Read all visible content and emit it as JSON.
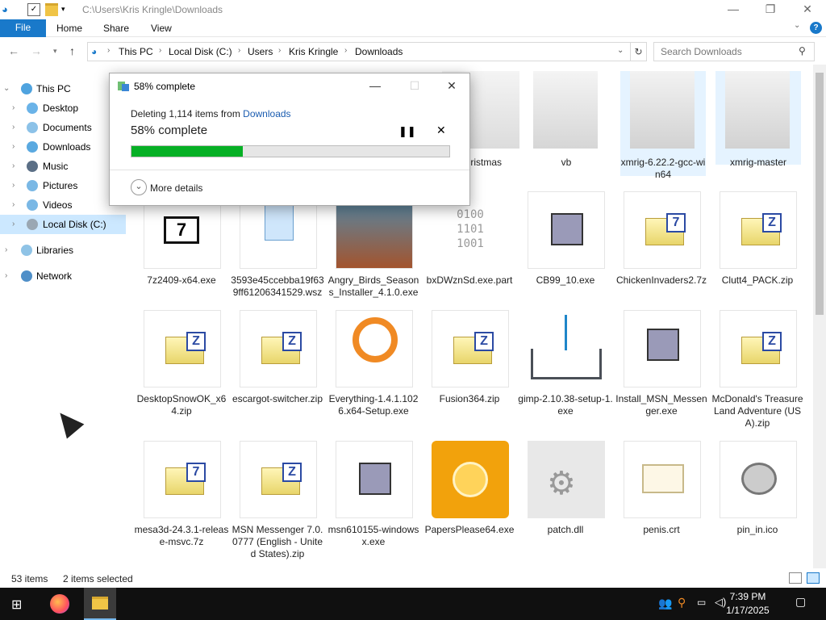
{
  "window": {
    "title": "C:\\Users\\Kris Kringle\\Downloads",
    "minimize": "—",
    "maximize": "❐",
    "close": "✕"
  },
  "ribbon": {
    "file": "File",
    "tabs": [
      "Home",
      "Share",
      "View"
    ],
    "help": "?"
  },
  "address": {
    "crumbs": [
      "This PC",
      "Local Disk (C:)",
      "Users",
      "Kris Kringle",
      "Downloads"
    ],
    "search_placeholder": "Search Downloads"
  },
  "nav": {
    "items": [
      {
        "label": "This PC",
        "icon": "computer-icon"
      },
      {
        "label": "Desktop",
        "icon": "desktop-icon"
      },
      {
        "label": "Documents",
        "icon": "documents-icon"
      },
      {
        "label": "Downloads",
        "icon": "downloads-icon"
      },
      {
        "label": "Music",
        "icon": "music-icon"
      },
      {
        "label": "Pictures",
        "icon": "pictures-icon"
      },
      {
        "label": "Videos",
        "icon": "videos-icon"
      },
      {
        "label": "Local Disk (C:)",
        "icon": "disk-icon"
      },
      {
        "label": "Libraries",
        "icon": "libraries-icon"
      },
      {
        "label": "Network",
        "icon": "network-icon"
      }
    ]
  },
  "files": {
    "row0": [
      {
        "name": "Christmas",
        "icon": "folder-icon"
      },
      {
        "name": "vb",
        "icon": "folder-icon"
      },
      {
        "name": "xmrig-6.22.2-gcc-win64",
        "icon": "folder-icon"
      },
      {
        "name": "xmrig-master",
        "icon": "folder-icon"
      }
    ],
    "row1": [
      {
        "name": "7z2409-x64.exe",
        "icon": "7zip-installer-icon"
      },
      {
        "name": "3593e45ccebba19f639ff61206341529.wsz",
        "icon": "wsz-file-icon"
      },
      {
        "name": "Angry_Birds_Seasons_Installer_4.1.0.exe",
        "icon": "angry-birds-icon"
      },
      {
        "name": "bxDWznSd.exe.part",
        "icon": "binary-file-icon"
      },
      {
        "name": "CB99_10.exe",
        "icon": "installer-icon"
      },
      {
        "name": "ChickenInvaders2.7z",
        "icon": "7z-archive-icon"
      },
      {
        "name": "Clutt4_PACK.zip",
        "icon": "zip-archive-icon"
      }
    ],
    "row2": [
      {
        "name": "DesktopSnowOK_x64.zip",
        "icon": "zip-archive-icon"
      },
      {
        "name": "escargot-switcher.zip",
        "icon": "zip-archive-icon"
      },
      {
        "name": "Everything-1.4.1.1026.x64-Setup.exe",
        "icon": "everything-search-icon"
      },
      {
        "name": "Fusion364.zip",
        "icon": "zip-archive-icon"
      },
      {
        "name": "gimp-2.10.38-setup-1.exe",
        "icon": "download-tray-icon"
      },
      {
        "name": "Install_MSN_Messenger.exe",
        "icon": "installer-icon"
      },
      {
        "name": "McDonald's Treasure Land Adventure (USA).zip",
        "icon": "zip-archive-icon"
      }
    ],
    "row3": [
      {
        "name": "mesa3d-24.3.1-release-msvc.7z",
        "icon": "7z-archive-icon"
      },
      {
        "name": "MSN Messenger 7.0.0777 (English - United States).zip",
        "icon": "zip-archive-icon"
      },
      {
        "name": "msn610155-windowsx.exe",
        "icon": "installer-icon"
      },
      {
        "name": "PapersPlease64.exe",
        "icon": "papers-please-icon"
      },
      {
        "name": "patch.dll",
        "icon": "dll-gear-icon"
      },
      {
        "name": "penis.crt",
        "icon": "certificate-icon"
      },
      {
        "name": "pin_in.ico",
        "icon": "ico-file-icon"
      }
    ]
  },
  "dialog": {
    "title": "58% complete",
    "line1_prefix": "Deleting 1,114 items from ",
    "line1_link": "Downloads",
    "percent_text": "58% complete",
    "progress": 0.35,
    "more_details": "More details",
    "pause": "❚❚",
    "cancel": "✕"
  },
  "status": {
    "count": "53 items",
    "selected": "2 items selected"
  },
  "taskbar": {
    "time": "7:39 PM",
    "date": "1/17/2025"
  },
  "colors": {
    "accent": "#1979ca",
    "progress": "#06b025",
    "selection": "#cce8ff"
  }
}
